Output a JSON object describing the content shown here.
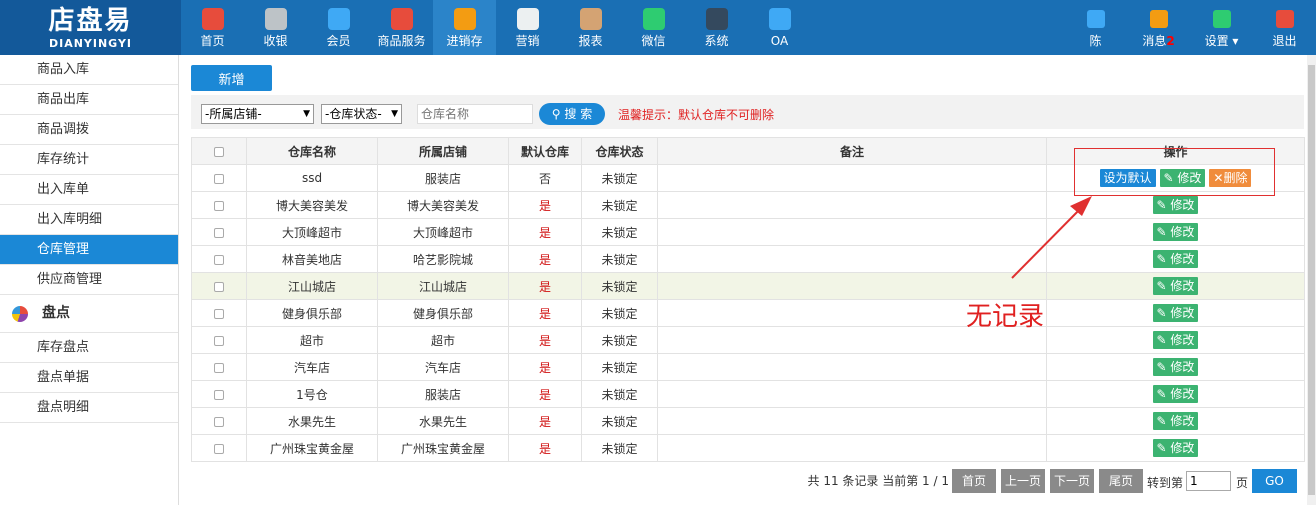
{
  "logo": {
    "cn": "店盘易",
    "en": "DIANYINGYI"
  },
  "nav": [
    {
      "label": "首页",
      "icon": "home-icon",
      "color": "#e74c3c"
    },
    {
      "label": "收银",
      "icon": "cash-register-icon",
      "color": "#bdc3c7"
    },
    {
      "label": "会员",
      "icon": "member-icon",
      "color": "#3fa9f5"
    },
    {
      "label": "商品服务",
      "icon": "goods-icon",
      "color": "#e74c3c"
    },
    {
      "label": "进销存",
      "icon": "inventory-icon",
      "color": "#f39c12"
    },
    {
      "label": "营销",
      "icon": "megaphone-icon",
      "color": "#ecf0f1"
    },
    {
      "label": "报表",
      "icon": "report-icon",
      "color": "#d4a373"
    },
    {
      "label": "微信",
      "icon": "wechat-icon",
      "color": "#2ecc71"
    },
    {
      "label": "系统",
      "icon": "monitor-icon",
      "color": "#34495e"
    },
    {
      "label": "OA",
      "icon": "oa-icon",
      "color": "#3fa9f5"
    }
  ],
  "right_nav": {
    "user": "陈",
    "user_color": "#3fa9f5",
    "message": "消息",
    "message_count": "2",
    "message_color": "#f39c12",
    "settings": "设置",
    "settings_color": "#2ecc71",
    "logout": "退出",
    "logout_color": "#e74c3c"
  },
  "sidebar": {
    "items_top": [
      "商品入库",
      "商品出库",
      "商品调拨",
      "库存统计",
      "出入库单",
      "出入库明细",
      "仓库管理",
      "供应商管理"
    ],
    "active": "仓库管理",
    "group": "盘点",
    "items_bottom": [
      "库存盘点",
      "盘点单据",
      "盘点明细"
    ]
  },
  "toolbar": {
    "add_label": "新增"
  },
  "filters": {
    "store": "-所属店铺-",
    "status": "-仓库状态-",
    "search_placeholder": "仓库名称",
    "search_label": "搜 索",
    "tip": "温馨提示：默认仓库不可删除"
  },
  "table": {
    "headers": [
      "仓库名称",
      "所属店铺",
      "默认仓库",
      "仓库状态",
      "备注",
      "操作"
    ],
    "rows": [
      {
        "name": "ssd",
        "store": "服装店",
        "default": "否",
        "status": "未锁定",
        "note": "",
        "actions": [
          "设为默认",
          "修改",
          "删除"
        ]
      },
      {
        "name": "博大美容美发",
        "store": "博大美容美发",
        "default": "是",
        "status": "未锁定",
        "note": "",
        "actions": [
          "修改"
        ]
      },
      {
        "name": "大顶峰超市",
        "store": "大顶峰超市",
        "default": "是",
        "status": "未锁定",
        "note": "",
        "actions": [
          "修改"
        ]
      },
      {
        "name": "林音美地店",
        "store": "哈艺影院城",
        "default": "是",
        "status": "未锁定",
        "note": "",
        "actions": [
          "修改"
        ]
      },
      {
        "name": "江山城店",
        "store": "江山城店",
        "default": "是",
        "status": "未锁定",
        "note": "",
        "actions": [
          "修改"
        ]
      },
      {
        "name": "健身俱乐部",
        "store": "健身俱乐部",
        "default": "是",
        "status": "未锁定",
        "note": "",
        "actions": [
          "修改"
        ]
      },
      {
        "name": "超市",
        "store": "超市",
        "default": "是",
        "status": "未锁定",
        "note": "",
        "actions": [
          "修改"
        ]
      },
      {
        "name": "汽车店",
        "store": "汽车店",
        "default": "是",
        "status": "未锁定",
        "note": "",
        "actions": [
          "修改"
        ]
      },
      {
        "name": "1号仓",
        "store": "服装店",
        "default": "是",
        "status": "未锁定",
        "note": "",
        "actions": [
          "修改"
        ]
      },
      {
        "name": "水果先生",
        "store": "水果先生",
        "default": "是",
        "status": "未锁定",
        "note": "",
        "actions": [
          "修改"
        ]
      },
      {
        "name": "广州珠宝黄金屋",
        "store": "广州珠宝黄金屋",
        "default": "是",
        "status": "未锁定",
        "note": "",
        "actions": [
          "修改"
        ]
      }
    ],
    "highlighted_row": 4
  },
  "annotation": {
    "text": "无记录"
  },
  "pager": {
    "info": "共 11 条记录 当前第 1 / 1",
    "first": "首页",
    "prev": "上一页",
    "next": "下一页",
    "last": "尾页",
    "jump_label": "转到第",
    "page_value": "1",
    "page_unit": "页",
    "go": "GO"
  }
}
